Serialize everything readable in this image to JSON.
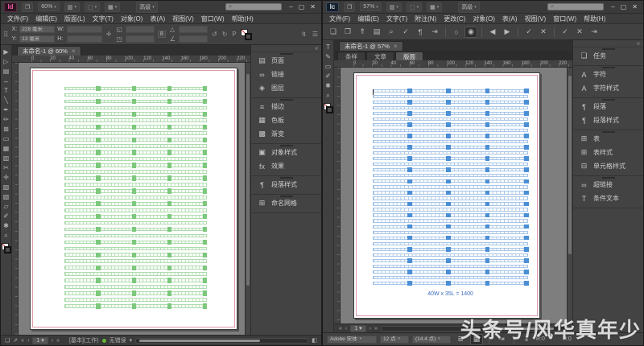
{
  "watermark": {
    "text": "头条号/风华真年少"
  },
  "indesign": {
    "logo": "Id",
    "zoom_level": "60%",
    "workspace": "高级",
    "menus": [
      "文件(F)",
      "编辑(E)",
      "版面(L)",
      "文字(T)",
      "对象(O)",
      "表(A)",
      "视图(V)",
      "窗口(W)",
      "帮助(H)"
    ],
    "control_bar": {
      "x_label": "X:",
      "x_value": "228 毫米",
      "y_label": "Y:",
      "y_value": "13 毫米",
      "w_label": "W:",
      "h_label": "H:",
      "link_glyph": "8"
    },
    "doc_tab": "未命名-1 @ 60%",
    "ruler_ticks": [
      "0",
      "20",
      "40",
      "60",
      "80",
      "100",
      "120",
      "140",
      "160",
      "180",
      "200",
      "220"
    ],
    "tools": [
      {
        "name": "selection-tool",
        "glyph": "▶"
      },
      {
        "name": "direct-selection-tool",
        "glyph": "▷"
      },
      {
        "name": "page-tool",
        "glyph": "▤"
      },
      {
        "name": "gap-tool",
        "glyph": "↔"
      },
      {
        "name": "type-tool",
        "glyph": "T"
      },
      {
        "name": "line-tool",
        "glyph": "╲"
      },
      {
        "name": "pen-tool",
        "glyph": "✒"
      },
      {
        "name": "pencil-tool",
        "glyph": "✏"
      },
      {
        "name": "frame-tool",
        "glyph": "⊠"
      },
      {
        "name": "rectangle-tool",
        "glyph": "▭"
      },
      {
        "name": "horizontal-grid-tool",
        "glyph": "▦"
      },
      {
        "name": "vertical-grid-tool",
        "glyph": "▥"
      },
      {
        "name": "scissors-tool",
        "glyph": "✂"
      },
      {
        "name": "free-transform-tool",
        "glyph": "✛"
      },
      {
        "name": "gradient-tool",
        "glyph": "▨"
      },
      {
        "name": "gradient-feather-tool",
        "glyph": "▧"
      },
      {
        "name": "note-tool",
        "glyph": "▱"
      },
      {
        "name": "eyedropper-tool",
        "glyph": "✐"
      },
      {
        "name": "hand-tool",
        "glyph": "✱"
      },
      {
        "name": "zoom-tool",
        "glyph": "⌕"
      }
    ],
    "panels": [
      {
        "group": 1,
        "icon": "pages-icon",
        "glyph": "▤",
        "label": "页面"
      },
      {
        "group": 1,
        "icon": "links-icon",
        "glyph": "∞",
        "label": "链接"
      },
      {
        "group": 1,
        "icon": "layers-icon",
        "glyph": "◈",
        "label": "图层"
      },
      {
        "group": 2,
        "icon": "stroke-icon",
        "glyph": "≡",
        "label": "描边"
      },
      {
        "group": 2,
        "icon": "swatches-icon",
        "glyph": "▦",
        "label": "色板"
      },
      {
        "group": 2,
        "icon": "gradient-icon",
        "glyph": "▩",
        "label": "渐变"
      },
      {
        "group": 3,
        "icon": "object-styles-icon",
        "glyph": "▣",
        "label": "对象样式"
      },
      {
        "group": 3,
        "icon": "effects-icon",
        "glyph": "fx",
        "label": "效果"
      },
      {
        "group": 4,
        "icon": "paragraph-styles-icon",
        "glyph": "¶",
        "label": "段落样式"
      },
      {
        "group": 5,
        "icon": "named-grids-icon",
        "glyph": "⊞",
        "label": "命名网格"
      }
    ],
    "status": {
      "page": "1",
      "profile": "[基本](工作)",
      "preflight": "无错误"
    },
    "grid": {
      "rows": 35,
      "cols": 40,
      "line_color": "#aedcae",
      "fill_color": "#7cc87c",
      "emphasis_cols": [
        10,
        20,
        30,
        40
      ],
      "emphasis_row_step": 2
    }
  },
  "incopy": {
    "logo": "Ic",
    "zoom_level": "57%",
    "workspace": "高级",
    "menus": [
      "文件(F)",
      "编辑(E)",
      "文字(T)",
      "附注(N)",
      "更改(C)",
      "对象(O)",
      "表(A)",
      "视图(V)",
      "窗口(W)",
      "帮助(H)"
    ],
    "toolbar_icons": [
      {
        "group": 1,
        "name": "new-doc-icon",
        "glyph": "❏"
      },
      {
        "group": 1,
        "name": "open-icon",
        "glyph": "❐"
      },
      {
        "group": 1,
        "name": "export-icon",
        "glyph": "⇑"
      },
      {
        "group": 1,
        "name": "print-icon",
        "glyph": "▤"
      },
      {
        "group": 1,
        "name": "find-icon",
        "glyph": "⌕"
      },
      {
        "group": 1,
        "name": "spellcheck-icon",
        "glyph": "✓"
      },
      {
        "group": 1,
        "name": "note-icon",
        "glyph": "¶"
      },
      {
        "group": 1,
        "name": "insert-note-icon",
        "glyph": "⇥"
      },
      {
        "group": 2,
        "name": "power-icon",
        "glyph": "○"
      },
      {
        "group": 2,
        "name": "track-changes-icon",
        "glyph": "◉",
        "active": true
      },
      {
        "group": 3,
        "name": "prev-change-icon",
        "glyph": "◀"
      },
      {
        "group": 3,
        "name": "next-change-icon",
        "glyph": "▶"
      },
      {
        "group": 4,
        "name": "accept-change-icon",
        "glyph": "✓"
      },
      {
        "group": 4,
        "name": "reject-change-icon",
        "glyph": "✕"
      },
      {
        "group": 5,
        "name": "accept-all-icon",
        "glyph": "✓"
      },
      {
        "group": 5,
        "name": "reject-all-icon",
        "glyph": "✕"
      },
      {
        "group": 5,
        "name": "notes-mode-icon",
        "glyph": "⇥"
      }
    ],
    "doc_tab": "未命名-1 @ 57%",
    "view_tabs": [
      "条样",
      "文章",
      "版面"
    ],
    "active_view_tab": "版面",
    "ruler_ticks": [
      "0",
      "20",
      "40",
      "60",
      "80",
      "100",
      "120",
      "140",
      "160",
      "180",
      "200",
      "220"
    ],
    "tools": [
      {
        "name": "type-tool",
        "glyph": "T"
      },
      {
        "name": "note-tool",
        "glyph": "✎"
      },
      {
        "name": "frame-tool",
        "glyph": "▭"
      },
      {
        "name": "eyedropper-tool",
        "glyph": "✐"
      },
      {
        "name": "hand-tool",
        "glyph": "✱"
      },
      {
        "name": "zoom-tool",
        "glyph": "⌕"
      }
    ],
    "panels": [
      {
        "group": 1,
        "icon": "assignments-icon",
        "glyph": "❏",
        "label": "任务"
      },
      {
        "group": 2,
        "icon": "character-icon",
        "glyph": "A",
        "label": "字符"
      },
      {
        "group": 2,
        "icon": "character-styles-icon",
        "glyph": "A",
        "label": "字符样式"
      },
      {
        "group": 3,
        "icon": "paragraph-icon",
        "glyph": "¶",
        "label": "段落"
      },
      {
        "group": 3,
        "icon": "paragraph-styles-icon",
        "glyph": "¶",
        "label": "段落样式"
      },
      {
        "group": 4,
        "icon": "table-icon",
        "glyph": "⊞",
        "label": "表"
      },
      {
        "group": 4,
        "icon": "table-styles-icon",
        "glyph": "⊞",
        "label": "表样式"
      },
      {
        "group": 4,
        "icon": "cell-styles-icon",
        "glyph": "⊟",
        "label": "单元格样式"
      },
      {
        "group": 5,
        "icon": "hyperlinks-icon",
        "glyph": "∞",
        "label": "超链接"
      },
      {
        "group": 5,
        "icon": "conditional-text-icon",
        "glyph": "T",
        "label": "条件文本"
      }
    ],
    "page_nav": {
      "page": "1"
    },
    "copyfit": {
      "font": "Adobe 宋体",
      "size": "12 点",
      "leading": "(14.4 点)",
      "r_value": "R:0",
      "h_value": "H:0"
    },
    "grid_caption": "40W x 35L = 1400",
    "caption_color": "#3f6fbe",
    "grid": {
      "rows": 35,
      "cols": 40,
      "line_color": "#a8c6e8",
      "fill_color": "#4a8fd6",
      "emphasis_cols": [
        10,
        20,
        30,
        40
      ],
      "emphasis_row_step": 2
    }
  }
}
